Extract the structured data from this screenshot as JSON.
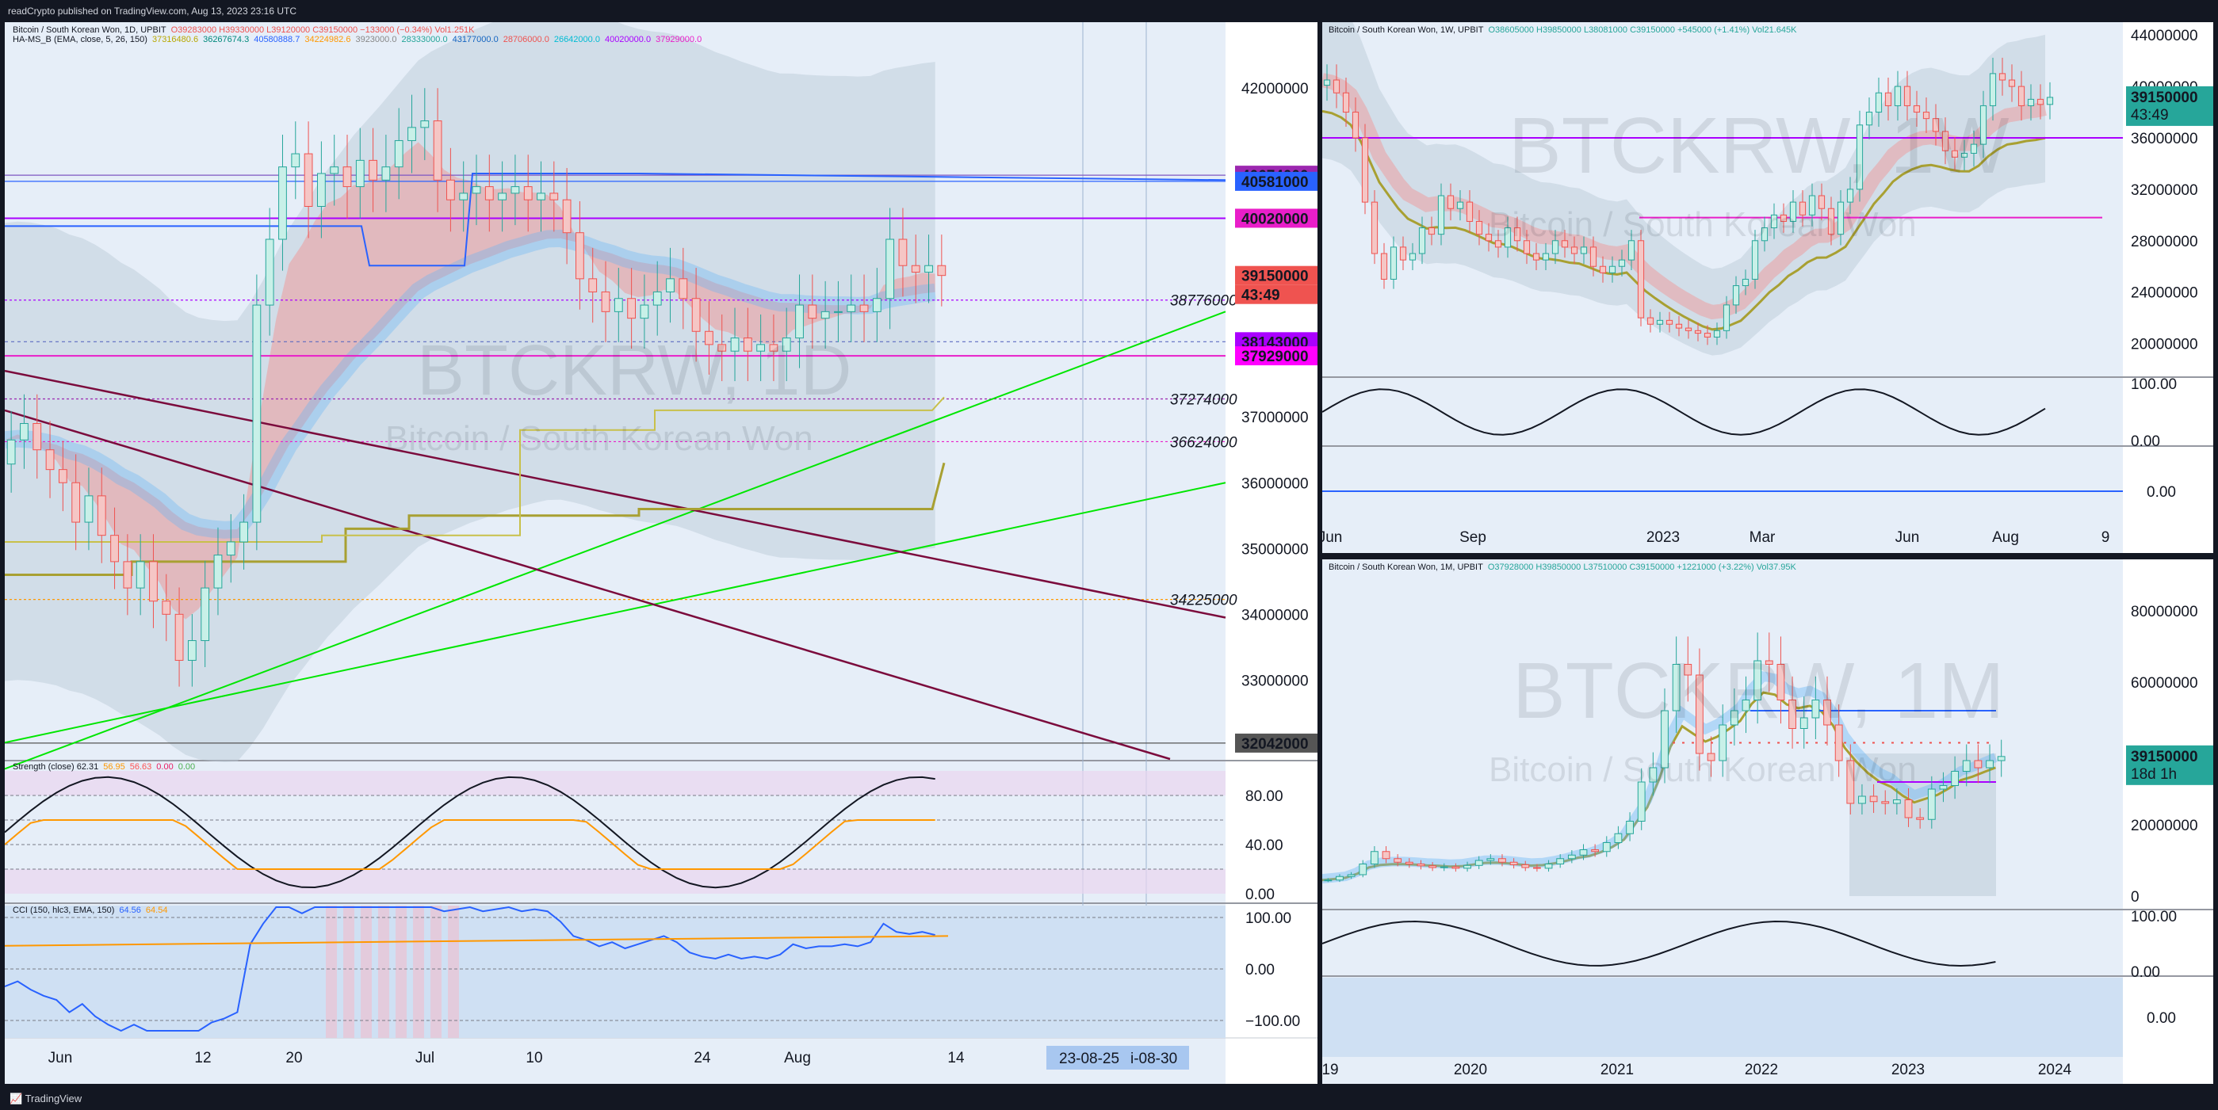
{
  "header": {
    "title": "readCrypto published on TradingView.com, Aug 13, 2023 23:16 UTC"
  },
  "footer": {
    "brand": "TradingView"
  },
  "colors": {
    "up": "#26a69a",
    "down": "#ef5350",
    "accent_purple": "#aa00ff",
    "green_line": "#00e600",
    "maroon_line": "#7b0b3c"
  },
  "main": {
    "legend": {
      "symbol": "Bitcoin / South Korean Won, 1D, UPBIT",
      "ohlc": "O39283000 H39330000 L39120000 C39150000 −133000 (−0.34%) Vol1.251K",
      "ha": "HA-MS_B (EMA, close, 5, 26, 150)",
      "ha_vals": [
        "37316480.6",
        "36267674.3",
        "40580888.7",
        "34224982.6",
        "3923000.0",
        "28333000.0",
        "43177000.0",
        "28706000.0",
        "26642000.0",
        "40020000.0",
        "37929000.0"
      ]
    },
    "watermark": {
      "title": "BTCKRW, 1D",
      "subtitle": "Bitcoin / South Korean Won"
    },
    "price_ticks": [
      "42000000",
      "37000000",
      "36000000",
      "35000000",
      "34000000",
      "33000000"
    ],
    "level_labels": [
      {
        "text": "38776000",
        "type": "plain"
      },
      {
        "text": "37274000",
        "type": "plain"
      },
      {
        "text": "36624000",
        "type": "plain"
      },
      {
        "text": "34225000",
        "type": "plain"
      }
    ],
    "price_tags": [
      {
        "text": "40674000",
        "bg": "#9c27b0"
      },
      {
        "text": "40581000",
        "bg": "#2962ff"
      },
      {
        "text": "40020000",
        "bg": "#e91ec9"
      },
      {
        "text": "39150000",
        "bg": "#ef5350"
      },
      {
        "text": "43:49",
        "bg": "#ef5350"
      },
      {
        "text": "38143000",
        "bg": "#aa00ff"
      },
      {
        "text": "37929000",
        "bg": "#ff00ff"
      },
      {
        "text": "32042000",
        "bg": "#555555"
      }
    ],
    "x_ticks": [
      "Jun",
      "12",
      "20",
      "Jul",
      "10",
      "24",
      "Aug",
      "14"
    ],
    "x_range_label": "23-08-25",
    "x_range_label2": "i-08-30",
    "strength": {
      "legend": "Strength (close) 62.31",
      "vals": [
        "56.95",
        "56.63",
        "0.00",
        "0.00"
      ],
      "ticks": [
        "80.00",
        "40.00",
        "0.00"
      ]
    },
    "cci": {
      "legend": "CCI (150, hlc3, EMA, 150)",
      "vals": [
        "64.56",
        "64.54"
      ],
      "ticks": [
        "100.00",
        "0.00",
        "−100.00"
      ]
    }
  },
  "weekly": {
    "legend": {
      "symbol": "Bitcoin / South Korean Won, 1W, UPBIT",
      "ohlc": "O38605000 H39850000 L38081000 C39150000 +545000 (+1.41%) Vol21.645K"
    },
    "watermark": {
      "title": "BTCKRW, 1W",
      "subtitle": "Bitcoin / South Korean Won"
    },
    "price_ticks": [
      "44000000",
      "40000000",
      "36000000",
      "32000000",
      "28000000",
      "24000000",
      "20000000"
    ],
    "price_tag": "39150000",
    "price_tag_time": "43:49",
    "x_ticks": [
      "Jun",
      "Sep",
      "2023",
      "Mar",
      "Jun",
      "Aug",
      "9"
    ],
    "strength_ticks": [
      "100.00",
      "0.00"
    ],
    "cci_ticks": [
      "0.00"
    ]
  },
  "monthly": {
    "legend": {
      "symbol": "Bitcoin / South Korean Won, 1M, UPBIT",
      "ohlc": "O37928000 H39850000 L37510000 C39150000 +1221000 (+3.22%) Vol37.95K"
    },
    "watermark": {
      "title": "BTCKRW, 1M",
      "subtitle": "Bitcoin / South Korean Won"
    },
    "price_ticks": [
      "80000000",
      "60000000",
      "20000000",
      "0"
    ],
    "price_tag": "39150000",
    "price_tag_time": "18d 1h",
    "x_ticks": [
      "19",
      "2020",
      "2021",
      "2022",
      "2023",
      "2024"
    ],
    "strength_ticks": [
      "100.00",
      "0.00"
    ],
    "cci_ticks": [
      "0.00"
    ]
  },
  "chart_data": [
    {
      "type": "candlestick",
      "title": "BTCKRW, 1D",
      "y_unit": "KRW",
      "ylim": [
        31800000,
        43000000
      ],
      "last": {
        "open": 39283000,
        "high": 39330000,
        "low": 39120000,
        "close": 39150000
      },
      "horizontal_levels": [
        40674000,
        40581000,
        40020000,
        38776000,
        38143000,
        37929000,
        37274000,
        36624000,
        34225000,
        32042000
      ],
      "closes": [
        36650000,
        36900000,
        36500000,
        36200000,
        36000000,
        35400000,
        35800000,
        35200000,
        34800000,
        34400000,
        34800000,
        34200000,
        34000000,
        33300000,
        33600000,
        34400000,
        34900000,
        35100000,
        35400000,
        38700000,
        39700000,
        40800000,
        41000000,
        40200000,
        40700000,
        40800000,
        40500000,
        40900000,
        40600000,
        40800000,
        41200000,
        41400000,
        41500000,
        40600000,
        40300000,
        40400000,
        40500000,
        40300000,
        40400000,
        40500000,
        40300000,
        40400000,
        40300000,
        39800000,
        39100000,
        38900000,
        38600000,
        38800000,
        38500000,
        38700000,
        38900000,
        39100000,
        38800000,
        38300000,
        38100000,
        38000000,
        38200000,
        38000000,
        38100000,
        38000000,
        38200000,
        38700000,
        38500000,
        38600000,
        38600000,
        38700000,
        38600000,
        38800000,
        39700000,
        39300000,
        39200000,
        39300000,
        39150000
      ]
    },
    {
      "type": "candlestick",
      "title": "BTCKRW, 1W",
      "y_unit": "KRW",
      "ylim": [
        18000000,
        45000000
      ],
      "last": {
        "open": 38605000,
        "high": 39850000,
        "low": 38081000,
        "close": 39150000
      },
      "closes": [
        40500000,
        39500000,
        38000000,
        36000000,
        31000000,
        27000000,
        25000000,
        27500000,
        26500000,
        27000000,
        29000000,
        28500000,
        31500000,
        30500000,
        31000000,
        29500000,
        28500000,
        28000000,
        27500000,
        29000000,
        28000000,
        27000000,
        26500000,
        27000000,
        28000000,
        27500000,
        27000000,
        27500000,
        26000000,
        25500000,
        26000000,
        26500000,
        28000000,
        22000000,
        21500000,
        21800000,
        21500000,
        21200000,
        21000000,
        20800000,
        20500000,
        21000000,
        23000000,
        24500000,
        25000000,
        28000000,
        29000000,
        30000000,
        29500000,
        31000000,
        30000000,
        31500000,
        30500000,
        28500000,
        31000000,
        32000000,
        37000000,
        38000000,
        39500000,
        38500000,
        40000000,
        38500000,
        38000000,
        37500000,
        36500000,
        35000000,
        34500000,
        34800000,
        35500000,
        38500000,
        41000000,
        40500000,
        40000000,
        38500000,
        39000000,
        38600000,
        39150000
      ]
    },
    {
      "type": "candlestick",
      "title": "BTCKRW, 1M",
      "y_unit": "KRW",
      "ylim": [
        0,
        90000000
      ],
      "last": {
        "open": 37928000,
        "high": 39850000,
        "low": 37510000,
        "close": 39150000
      },
      "closes": [
        4500000,
        5500000,
        6000000,
        9000000,
        12500000,
        10500000,
        9500000,
        9000000,
        8500000,
        8000000,
        8200000,
        7800000,
        8600000,
        10000000,
        10500000,
        9500000,
        8800000,
        8000000,
        7800000,
        9000000,
        10500000,
        11500000,
        13000000,
        12500000,
        15000000,
        17500000,
        21000000,
        32000000,
        36000000,
        52000000,
        65000000,
        62000000,
        40000000,
        38000000,
        48000000,
        52000000,
        55000000,
        66000000,
        65000000,
        55000000,
        47000000,
        50000000,
        55000000,
        48000000,
        38000000,
        26000000,
        28000000,
        26500000,
        26000000,
        27000000,
        22000000,
        21500000,
        30000000,
        31000000,
        35000000,
        38000000,
        36000000,
        38000000,
        39150000
      ]
    }
  ]
}
